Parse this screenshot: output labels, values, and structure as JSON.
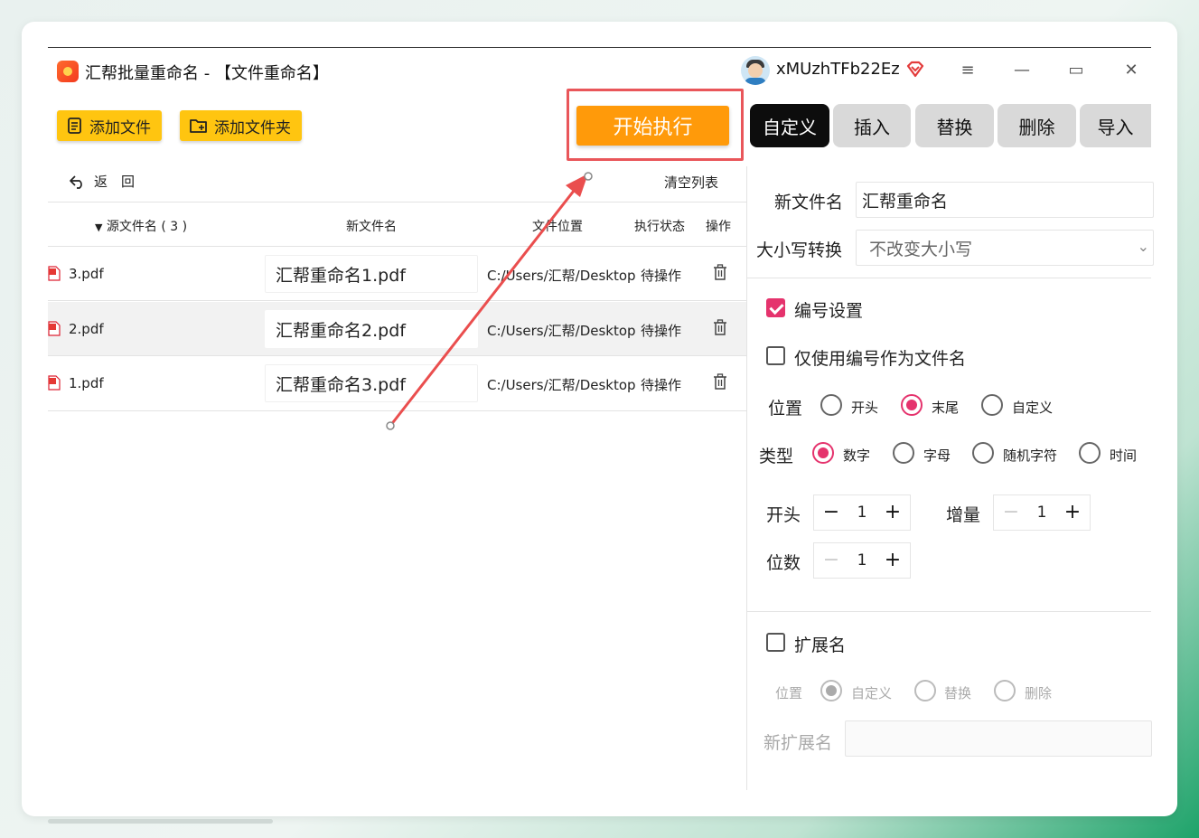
{
  "window": {
    "title": "汇帮批量重命名 - 【文件重命名】",
    "username": "xMUzhTFb22Ez",
    "controls": {
      "menu": "≡",
      "minimize": "—",
      "maximize": "▭",
      "close": "✕"
    }
  },
  "toolbar": {
    "add_file": "添加文件",
    "add_folder": "添加文件夹",
    "start": "开始执行"
  },
  "tabs": [
    {
      "label": "自定义",
      "active": true
    },
    {
      "label": "插入",
      "active": false
    },
    {
      "label": "替换",
      "active": false
    },
    {
      "label": "删除",
      "active": false
    },
    {
      "label": "导入",
      "active": false
    }
  ],
  "list": {
    "back": "返　回",
    "clear": "清空列表",
    "columns": {
      "source": "源文件名 ( 3 )",
      "newname": "新文件名",
      "location": "文件位置",
      "status": "执行状态",
      "action": "操作"
    },
    "rows": [
      {
        "source": "3.pdf",
        "newname": "汇帮重命名1.pdf",
        "location": "C:/Users/汇帮/Desktop",
        "status": "待操作",
        "selected": false
      },
      {
        "source": "2.pdf",
        "newname": "汇帮重命名2.pdf",
        "location": "C:/Users/汇帮/Desktop",
        "status": "待操作",
        "selected": true
      },
      {
        "source": "1.pdf",
        "newname": "汇帮重命名3.pdf",
        "location": "C:/Users/汇帮/Desktop",
        "status": "待操作",
        "selected": false
      }
    ]
  },
  "panel": {
    "new_name_label": "新文件名",
    "new_name_value": "汇帮重命名",
    "case_label": "大小写转换",
    "case_value": "不改变大小写",
    "numbering_label": "编号设置",
    "numbering_checked": true,
    "only_number_label": "仅使用编号作为文件名",
    "only_number_checked": false,
    "position_label": "位置",
    "position_options": [
      "开头",
      "末尾",
      "自定义"
    ],
    "position_selected": "末尾",
    "type_label": "类型",
    "type_options": [
      "数字",
      "字母",
      "随机字符",
      "时间"
    ],
    "type_selected": "数字",
    "start_label": "开头",
    "start_value": "1",
    "increment_label": "增量",
    "increment_value": "1",
    "digits_label": "位数",
    "digits_value": "1",
    "extension_label": "扩展名",
    "extension_checked": false,
    "ext_position_label": "位置",
    "ext_position_options": [
      "自定义",
      "替换",
      "删除"
    ],
    "ext_position_selected": "自定义",
    "new_ext_label": "新扩展名",
    "new_ext_value": ""
  },
  "colors": {
    "accent_yellow": "#ffc510",
    "start_orange": "#ff9a0a",
    "highlight_red": "#e9565a",
    "check_pink": "#e5336d"
  }
}
